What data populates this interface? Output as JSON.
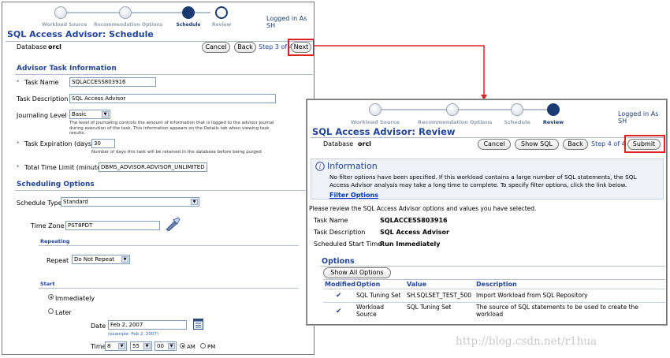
{
  "left": {
    "train": {
      "steps": [
        "Workload Source",
        "Recommendation Options",
        "Schedule",
        "Review"
      ],
      "current": 2
    },
    "logged_in": "Logged in As SH",
    "title": "SQL Access Advisor: Schedule",
    "database_label": "Database",
    "database_value": "orcl",
    "buttons": {
      "cancel": "Cancel",
      "back": "Back",
      "step": "Step 3 of 4",
      "next": "Next"
    },
    "advisor_section": "Advisor Task Information",
    "task_name_label": "Task Name",
    "task_name_value": "SQLACCESS803916",
    "task_desc_label": "Task Description",
    "task_desc_value": "SQL Access Advisor",
    "journaling_label": "Journaling Level",
    "journaling_value": "Basic",
    "journaling_hint": "The level of journaling controls the amount of information that is logged to the advisor journal during execution of the task. This information appears on the Details tab when viewing task results.",
    "expiration_label": "Task Expiration (days)",
    "expiration_value": "30",
    "expiration_hint": "Number of days this task will be retained in the database before being purged",
    "time_limit_label": "Total Time Limit (minutes)",
    "time_limit_value": "DBMS_ADVISOR.ADVISOR_UNLIMITED",
    "scheduling_section": "Scheduling Options",
    "schedule_type_label": "Schedule Type",
    "schedule_type_value": "Standard",
    "time_zone_label": "Time Zone",
    "time_zone_value": "PST8PDT",
    "repeating_label": "Repeating",
    "repeat_label": "Repeat",
    "repeat_value": "Do Not Repeat",
    "start_label": "Start",
    "immediately_label": "Immediately",
    "later_label": "Later",
    "date_label": "Date",
    "date_value": "Feb 2, 2007",
    "date_example": "(example: Feb 2, 2007)",
    "time_label": "Time",
    "time_hour": "8",
    "time_min": "55",
    "time_sec": "00",
    "am_label": "AM",
    "pm_label": "PM"
  },
  "right": {
    "train": {
      "steps": [
        "Workload Source",
        "Recommendation Options",
        "Schedule",
        "Review"
      ],
      "current": 3
    },
    "logged_in": "Logged in As SH",
    "title": "SQL Access Advisor: Review",
    "database_label": "Database",
    "database_value": "orcl",
    "buttons": {
      "cancel": "Cancel",
      "show_sql": "Show SQL",
      "back": "Back",
      "step": "Step 4 of 4",
      "submit": "Submit"
    },
    "info_title": "Information",
    "info_text_1": "No filter options have been specified. If this workload contains a large number of SQL statements, the SQL",
    "info_text_2": "Access Advisor analysis may take a long time to complete. To specify filter options, click the link below.",
    "filter_link": "Filter Options",
    "review_text": "Please review the SQL Access Advisor options and values you have selected.",
    "task_name_label": "Task Name",
    "task_name_value": "SQLACCESS803916",
    "task_desc_label": "Task Description",
    "task_desc_value": "SQL Access Advisor",
    "start_time_label": "Scheduled Start Time",
    "start_time_value": "Run Immediately",
    "options_section": "Options",
    "show_all_button": "Show All Options",
    "table": {
      "headers": [
        "Modified",
        "Option",
        "Value",
        "Description"
      ],
      "rows": [
        {
          "option": "SQL Tuning Set",
          "value": "SH.SQLSET_TEST_500",
          "description": "Import Workload from SQL Repository"
        },
        {
          "option": "Workload Source",
          "value": "SQL Tuning Set",
          "description": "The source of SQL statements to be used to create the workload"
        }
      ]
    }
  },
  "watermark": "http://blog.csdn.net/r1hua",
  "colors": {
    "accent": "#21449c",
    "highlight": "#e02020"
  }
}
